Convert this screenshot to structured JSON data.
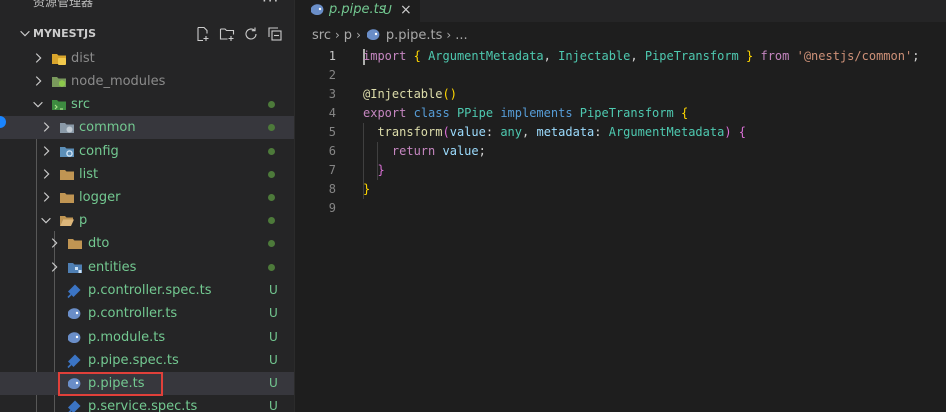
{
  "sidebar": {
    "title": "资源管理器",
    "more": "···",
    "section": "MYNESTJS",
    "items": [
      {
        "label": "dist",
        "kind": "folder-dist",
        "badge": ""
      },
      {
        "label": "node_modules",
        "kind": "folder-node",
        "badge": ""
      },
      {
        "label": "src",
        "kind": "folder-src",
        "badge": ""
      },
      {
        "label": "common",
        "kind": "folder-common",
        "badge": ""
      },
      {
        "label": "config",
        "kind": "folder-config",
        "badge": ""
      },
      {
        "label": "list",
        "kind": "folder",
        "badge": ""
      },
      {
        "label": "logger",
        "kind": "folder",
        "badge": ""
      },
      {
        "label": "p",
        "kind": "folder-open",
        "badge": ""
      },
      {
        "label": "dto",
        "kind": "folder",
        "badge": ""
      },
      {
        "label": "entities",
        "kind": "folder-entities",
        "badge": ""
      },
      {
        "label": "p.controller.spec.ts",
        "kind": "spec-file",
        "badge": "U"
      },
      {
        "label": "p.controller.ts",
        "kind": "nest-file",
        "badge": "U"
      },
      {
        "label": "p.module.ts",
        "kind": "nest-file",
        "badge": "U"
      },
      {
        "label": "p.pipe.spec.ts",
        "kind": "spec-file",
        "badge": "U"
      },
      {
        "label": "p.pipe.ts",
        "kind": "nest-file",
        "badge": "U"
      },
      {
        "label": "p.service.spec.ts",
        "kind": "spec-file",
        "badge": "U"
      }
    ]
  },
  "editor": {
    "tab": {
      "label": "p.pipe.ts",
      "badge": "U",
      "close": "×"
    },
    "breadcrumb": [
      "src",
      "p",
      "p.pipe.ts",
      "..."
    ],
    "line_numbers": [
      "1",
      "2",
      "3",
      "4",
      "5",
      "6",
      "7",
      "8",
      "9"
    ],
    "code": {
      "l1": {
        "import": "import",
        "lb": "{",
        "a": "ArgumentMetadata",
        "c1": ",",
        "b": "Injectable",
        "c2": ",",
        "c": "PipeTransform",
        "rb": "}",
        "from": "from",
        "str": "'@nestjs/common'",
        "semi": ";"
      },
      "l3": {
        "at": "@",
        "dec": "Injectable",
        "parens": "()"
      },
      "l4": {
        "export": "export",
        "class": "class",
        "name": "PPipe",
        "implements": "implements",
        "iface": "PipeTransform",
        "lb": "{"
      },
      "l5": {
        "fn": "transform",
        "lp": "(",
        "p1": "value",
        "c1": ":",
        "t1": "any",
        "comma": ",",
        "p2": "metadata",
        "c2": ":",
        "t2": "ArgumentMetadata",
        "rp": ")",
        "lb": "{"
      },
      "l6": {
        "ret": "return",
        "val": "value",
        "semi": ";"
      },
      "l7": {
        "rb": "}"
      },
      "l8": {
        "rb": "}"
      }
    }
  }
}
